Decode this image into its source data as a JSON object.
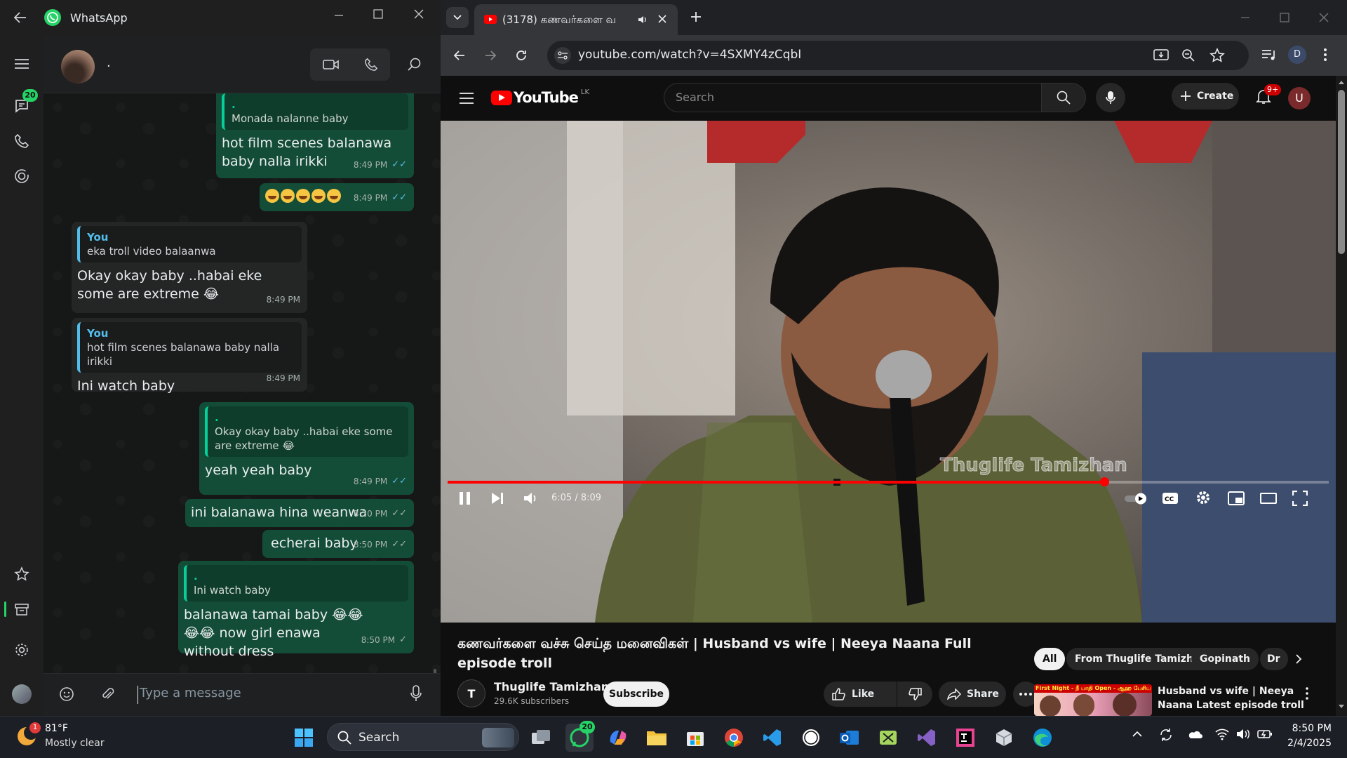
{
  "whatsapp": {
    "app_title": "WhatsApp",
    "contact_name": ".",
    "unread_badge": "20",
    "input_placeholder": "Type a message",
    "messages": [
      {
        "quote_name": ".",
        "quote_text": "Monada nalanne baby",
        "text": "hot film scenes balanawa baby nalla irikki",
        "time": "8:49 PM"
      },
      {
        "text": "😂😂😂😂😂",
        "time": "8:49 PM"
      },
      {
        "quote_name": "You",
        "quote_text": "eka troll video balaanwa",
        "text": "Okay okay baby ..habai eke some are extreme 😂",
        "time": "8:49 PM"
      },
      {
        "quote_name": "You",
        "quote_text": "hot film scenes balanawa baby nalla irikki",
        "text": "Ini watch baby",
        "time": "8:49 PM"
      },
      {
        "quote_name": ".",
        "quote_text": "Okay okay baby ..habai eke some are extreme 😂",
        "text": "yeah yeah baby",
        "time": "8:49 PM"
      },
      {
        "text": "ini balanawa hina weanwa",
        "time": "8:50 PM"
      },
      {
        "text": "echerai baby",
        "time": "8:50 PM"
      },
      {
        "quote_name": ".",
        "quote_text": "Ini watch baby",
        "text": "balanawa tamai baby 😂😂😂😂 now girl enawa without dress",
        "time": "8:50 PM"
      }
    ]
  },
  "browser": {
    "tab_title": "(3178) கணவர்களை வ",
    "url": "youtube.com/watch?v=4SXMY4zCqbI",
    "profile_letter": "D"
  },
  "youtube": {
    "logo_text": "YouTube",
    "region": "LK",
    "search_placeholder": "Search",
    "create_label": "Create",
    "notif_badge": "9+",
    "avatar_letter": "U",
    "watermark": "Thuglife Tamizhan",
    "time_current": "6:05",
    "time_total": "8:09",
    "time_display": "6:05 / 8:09",
    "progress": 0.745,
    "video_title": "கணவர்களை வச்சு செய்த மனைவிகள் | Husband vs wife | Neeya Naana Full episode troll",
    "channel_name": "Thuglife Tamizhan",
    "subscribers": "29.6K subscribers",
    "subscribe_label": "Subscribe",
    "like_label": "Like",
    "share_label": "Share",
    "chips": [
      "All",
      "From Thuglife Tamizhan",
      "Gopinath",
      "Dr"
    ],
    "rec_title": "Husband vs wife | Neeya Naana Latest episode troll",
    "rec_thumb_text": "First Night - நீ பாதி Open - ஆஹ பேசிய பேசர"
  },
  "taskbar": {
    "weather_temp": "81°F",
    "weather_desc": "Mostly clear",
    "weather_badge": "1",
    "search_label": "Search",
    "whatsapp_badge": "20",
    "clock_time": "8:50 PM",
    "clock_date": "2/4/2025"
  },
  "colors": {
    "wa_outgoing": "#144d37",
    "wa_incoming": "#242626",
    "wa_green": "#25d366",
    "yt_red": "#ff0000"
  }
}
